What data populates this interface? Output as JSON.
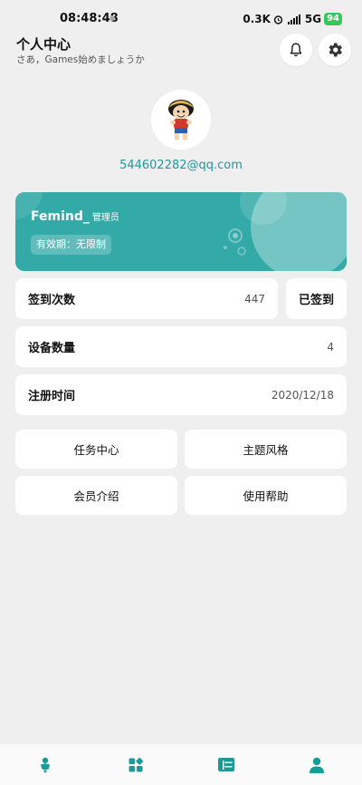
{
  "status_bar": {
    "time": "08:48:48",
    "network_speed": "0.3K",
    "network_type": "5G",
    "battery": "94"
  },
  "header": {
    "title": "个人中心",
    "subtitle": "さあ，Games始めましょうか"
  },
  "user": {
    "email": "544602282@qq.com"
  },
  "member_card": {
    "name": "Femind_",
    "role": "管理员",
    "validity": "有效期：无限制",
    "color": "#33aaa8"
  },
  "stats": {
    "checkin_label": "签到次数",
    "checkin_count": "447",
    "checked_in_button": "已签到",
    "devices_label": "设备数量",
    "devices_count": "4",
    "register_label": "注册时间",
    "register_date": "2020/12/18"
  },
  "actions": {
    "task_center": "任务中心",
    "theme_style": "主题风格",
    "member_intro": "会员介绍",
    "help": "使用帮助"
  },
  "bottom_nav": {
    "icons": [
      "person-pin-icon",
      "apps-icon",
      "list-icon",
      "profile-icon"
    ],
    "active_color": "#1a9a98"
  },
  "colors": {
    "accent": "#1a9a98",
    "background": "#efefef"
  }
}
